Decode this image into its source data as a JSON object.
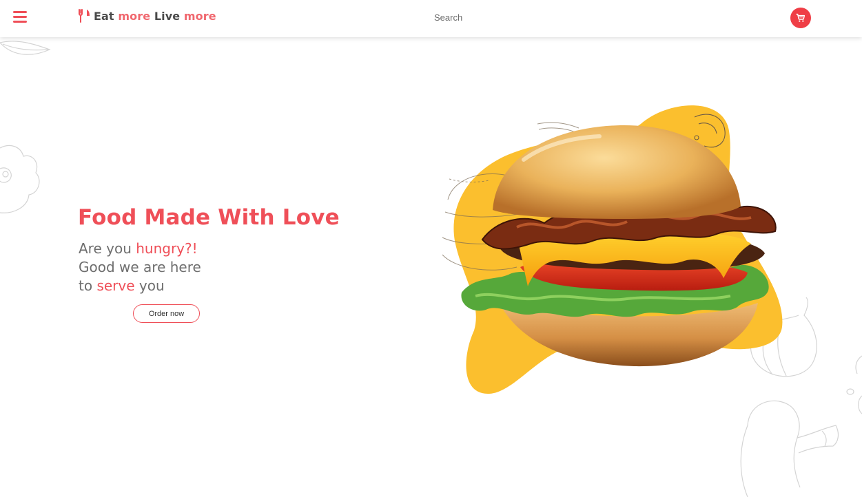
{
  "header": {
    "brand": {
      "word1": "Eat",
      "word2": "more",
      "word3": "Live",
      "word4": "more"
    },
    "search": {
      "placeholder": "Search",
      "value": ""
    },
    "menu_icon": "hamburger-menu-icon",
    "cart_icon": "shopping-cart-icon",
    "logo_icon": "fork-knife-icon"
  },
  "hero": {
    "title": "Food Made With Love",
    "line1_a": "Are you ",
    "line1_b": "hungry?!",
    "line2": "Good we are here",
    "line3_a": "to ",
    "line3_b": "serve",
    "line3_c": " you",
    "cta": "Order now",
    "image": "bacon-cheeseburger-image"
  },
  "colors": {
    "accent": "#ef4f58",
    "cart": "#ef3e46",
    "blob": "#fbbf2e",
    "text": "#6e6e6e"
  }
}
